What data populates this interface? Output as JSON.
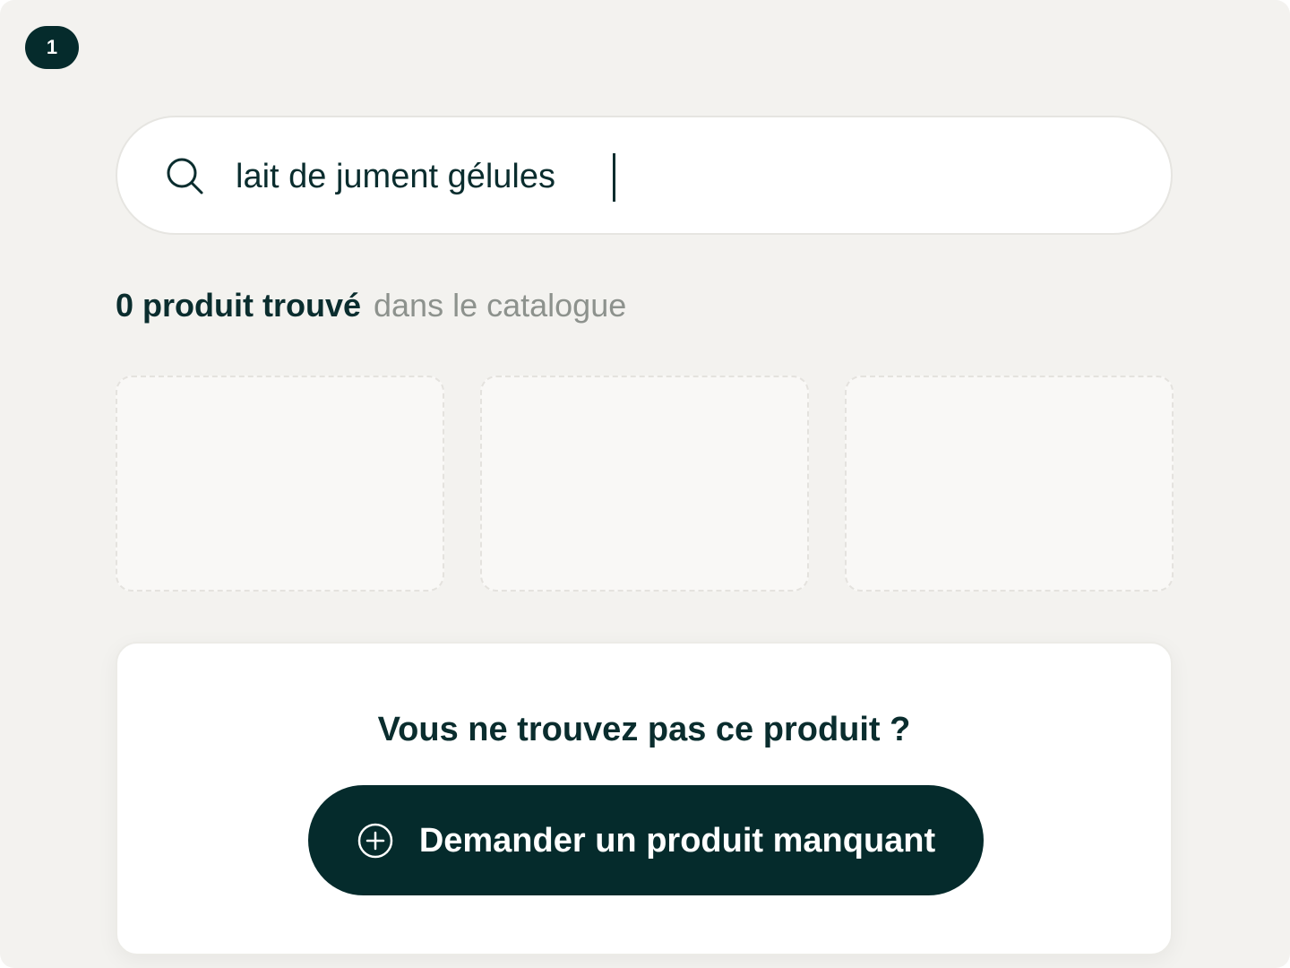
{
  "step": {
    "number": "1"
  },
  "search": {
    "query": "lait de jument gélules",
    "icon": "search-icon"
  },
  "results": {
    "count_label": "0 produit trouvé",
    "context_label": "dans le catalogue",
    "placeholder_count": 3
  },
  "missing": {
    "title": "Vous ne trouvez pas ce produit ?",
    "button_label": "Demander un produit manquant",
    "button_icon": "plus-circle-icon"
  },
  "colors": {
    "background": "#f3f2ef",
    "primary": "#052b2c",
    "text": "#0a2d2e",
    "muted_text": "#8d928d",
    "surface": "#ffffff"
  }
}
